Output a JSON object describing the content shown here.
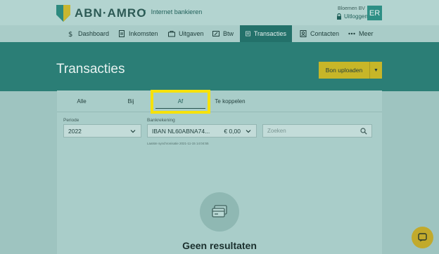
{
  "header": {
    "logo_text": "ABN·AMRO",
    "back_link": "Internet bankieren",
    "company": "Bloemen BV",
    "logout": "Uitloggen",
    "avatar_initials": "ER"
  },
  "nav": {
    "items": [
      {
        "label": "Dashboard",
        "icon": "dollar-icon"
      },
      {
        "label": "Inkomsten",
        "icon": "document-icon"
      },
      {
        "label": "Uitgaven",
        "icon": "cart-icon"
      },
      {
        "label": "Btw",
        "icon": "vat-icon"
      },
      {
        "label": "Transacties",
        "icon": "transactions-icon",
        "active": true
      },
      {
        "label": "Contacten",
        "icon": "contacts-icon"
      },
      {
        "label": "Meer",
        "icon": "more-icon"
      }
    ]
  },
  "page": {
    "title": "Transacties",
    "upload_button": "Bon uploaden"
  },
  "tabs": {
    "items": [
      {
        "label": "Alle"
      },
      {
        "label": "Bij"
      },
      {
        "label": "Af",
        "active": true
      },
      {
        "label": "Te koppelen"
      }
    ]
  },
  "filters": {
    "period_label": "Periode",
    "period_value": "2022",
    "account_label": "Bankrekening",
    "account_value": "IBAN NL60ABNA74...",
    "account_amount": "€ 0,00",
    "search_placeholder": "Zoeken",
    "sync_text": "Laatste synchronisatie 2021-11-15 14:04:55"
  },
  "empty_state": {
    "title": "Geen resultaten"
  },
  "colors": {
    "brand_green": "#2b7e76",
    "brand_yellow": "#c7b628",
    "highlight": "#f6e20b"
  }
}
